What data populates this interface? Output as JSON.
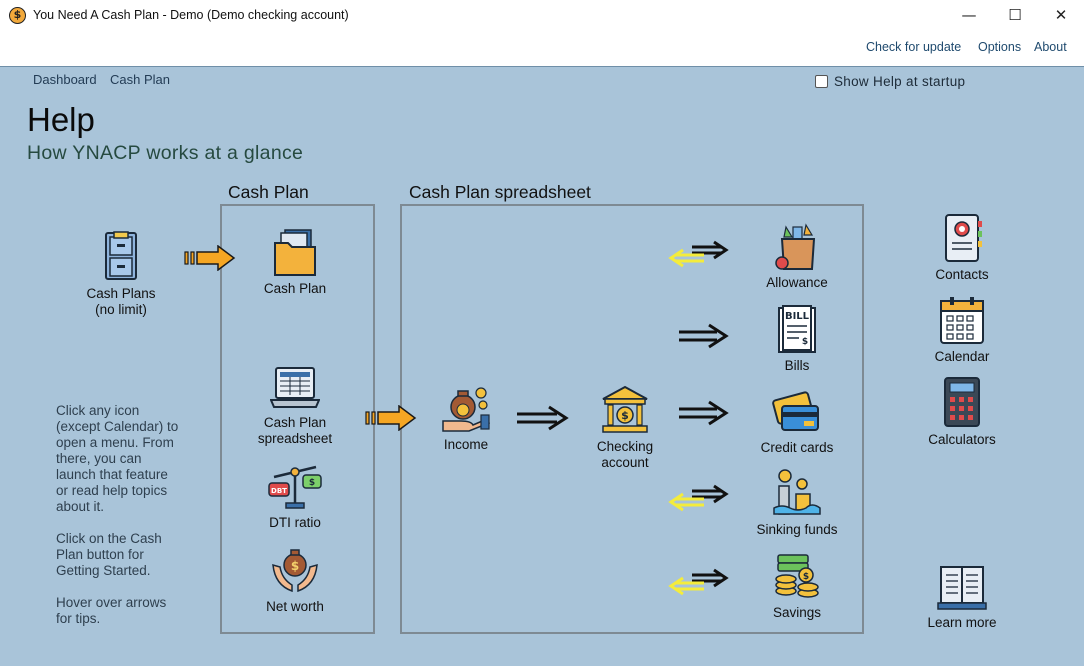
{
  "window": {
    "title": "You Need A Cash Plan - Demo (Demo checking account)",
    "minimize": "—",
    "maximize": "☐",
    "close": "✕"
  },
  "menu": {
    "check_update": "Check for update",
    "options": "Options",
    "about": "About"
  },
  "nav": {
    "dashboard": "Dashboard",
    "cash_plan": "Cash Plan"
  },
  "show_help": {
    "label": "Show Help at startup",
    "checked": false
  },
  "page": {
    "title": "Help",
    "subtitle": "How YNACP works at a glance"
  },
  "sections": {
    "cash_plan": "Cash Plan",
    "spreadsheet": "Cash Plan spreadsheet"
  },
  "nodes": {
    "cash_plans_line1": "Cash Plans",
    "cash_plans_line2": "(no limit)",
    "cash_plan": "Cash Plan",
    "spreadsheet_line1": "Cash Plan",
    "spreadsheet_line2": "spreadsheet",
    "dti": "DTI ratio",
    "net_worth": "Net worth",
    "income": "Income",
    "checking_line1": "Checking",
    "checking_line2": "account",
    "allowance": "Allowance",
    "bills": "Bills",
    "credit_cards": "Credit cards",
    "sinking_funds": "Sinking funds",
    "savings": "Savings",
    "contacts": "Contacts",
    "calendar": "Calendar",
    "calculators": "Calculators",
    "learn_more": "Learn more"
  },
  "hints": {
    "p1": [
      "Click any icon",
      "(except Calendar) to",
      "open a menu. From",
      "there, you can",
      "launch that feature",
      "or read help topics",
      "about it."
    ],
    "p2": [
      "Click on the Cash",
      "Plan button for",
      "Getting Started."
    ],
    "p3": [
      "Hover over arrows",
      "for tips."
    ]
  },
  "icon_text": {
    "app": "$",
    "bill": "BILL",
    "dti": "DBT",
    "dollar": "$"
  },
  "colors": {
    "background": "#a9c4d9",
    "accent_orange": "#f5a623",
    "arrow_yellow": "#f4ec3c",
    "border": "#7e8a93"
  }
}
